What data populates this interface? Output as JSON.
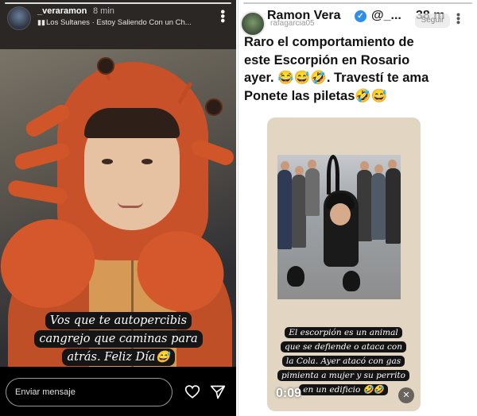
{
  "left_story": {
    "username": "_veraramon",
    "time_ago": "8 min",
    "music_icon": "music-bars-icon",
    "music": "Los Sultanes · Estoy Saliendo Con un Ch...",
    "more_icon": "more-vertical-icon",
    "caption_lines": [
      "Vos que te autopercibis",
      "cangrejo que caminas para",
      "atrás. Feliz Día😅"
    ],
    "message_placeholder": "Enviar mensaje",
    "heart_icon": "heart-icon",
    "send_icon": "send-icon"
  },
  "right_story": {
    "display_name": "Ramon Vera",
    "verified_icon": "verified-badge-icon",
    "handle": "@_...",
    "time_ago": "38 m",
    "overlay_username": "rafagarcia05",
    "follow_label": "Seguir",
    "more_icon": "more-vertical-icon",
    "tweet_lines": [
      "Raro el comportamiento de",
      "este Escorpión  en Rosario",
      "ayer. 😂😅🤣. Travestí te ama",
      "Ponete las piletas🤣😅"
    ],
    "video_caption_lines": [
      "El escorpión es un animal",
      "que se defiende o ataca con",
      "la Cola. Ayer atacó con gas",
      "pimienta a mujer y su perrito",
      "en un edificio 🤣🤣"
    ],
    "video_timer": "0:09",
    "mute_icon": "muted-speaker-icon"
  },
  "colors": {
    "costume_orange": "#c9512a",
    "caption_bg": "#151515",
    "verified_blue": "#2f8fe8"
  }
}
